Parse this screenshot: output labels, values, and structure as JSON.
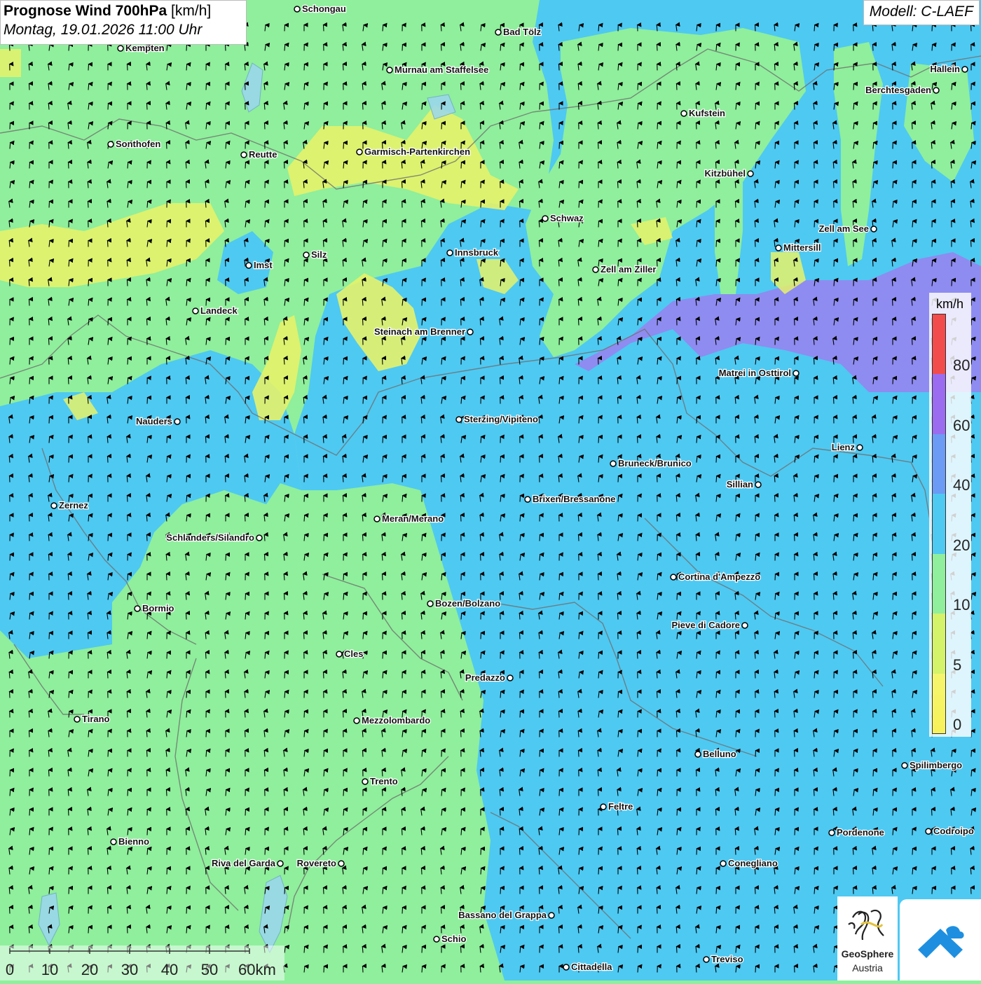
{
  "header": {
    "title_bold": "Prognose Wind 700hPa",
    "title_unit": "[km/h]",
    "date": "Montag, 19.01.2026 11:00 Uhr",
    "model": "Modell: C-LAEF"
  },
  "legend": {
    "unit": "km/h",
    "ticks": [
      "0",
      "5",
      "10",
      "20",
      "40",
      "60",
      "80"
    ],
    "colors": [
      "#f5f56e",
      "#d4f26a",
      "#8fef9c",
      "#4ec9f2",
      "#6b9bf5",
      "#9b6cf0",
      "#f24c4c"
    ]
  },
  "scale_bar": {
    "ticks": [
      "0",
      "10",
      "20",
      "30",
      "40",
      "50",
      "60km"
    ]
  },
  "logos": {
    "geosphere_line1": "GeoSphere",
    "geosphere_line2": "Austria"
  },
  "wind_field": {
    "dominant_direction": "north",
    "zones": [
      {
        "name": "west-green",
        "speed_class": "10-20"
      },
      {
        "name": "east-blue",
        "speed_class": "20-40"
      },
      {
        "name": "purple-band",
        "speed_class": "40-60"
      },
      {
        "name": "yellow-patches",
        "speed_class": "5-10"
      }
    ]
  },
  "cities": [
    {
      "name": "Schongau"
    },
    {
      "name": "Bad Tölz"
    },
    {
      "name": "Kempten"
    },
    {
      "name": "Murnau am Staffelsee"
    },
    {
      "name": "Hallein"
    },
    {
      "name": "Berchtesgaden"
    },
    {
      "name": "Kufstein"
    },
    {
      "name": "Sonthofen"
    },
    {
      "name": "Reutte"
    },
    {
      "name": "Garmisch-Partenkirchen"
    },
    {
      "name": "Kitzbühel"
    },
    {
      "name": "Schwaz"
    },
    {
      "name": "Zell am See"
    },
    {
      "name": "Silz"
    },
    {
      "name": "Innsbruck"
    },
    {
      "name": "Mittersill"
    },
    {
      "name": "Imst"
    },
    {
      "name": "Zell am Ziller"
    },
    {
      "name": "Landeck"
    },
    {
      "name": "Steinach am Brenner"
    },
    {
      "name": "Matrei in Osttirol"
    },
    {
      "name": "Nauders"
    },
    {
      "name": "Sterzing/Vipiteno"
    },
    {
      "name": "Lienz"
    },
    {
      "name": "Bruneck/Brunico"
    },
    {
      "name": "Sillian"
    },
    {
      "name": "Zernez"
    },
    {
      "name": "Brixen/Bressanone"
    },
    {
      "name": "Meran/Merano"
    },
    {
      "name": "Schlanders/Silandro"
    },
    {
      "name": "Cortina d'Ampezzo"
    },
    {
      "name": "Bozen/Bolzano"
    },
    {
      "name": "Bormio"
    },
    {
      "name": "Pieve di Cadore"
    },
    {
      "name": "Cles"
    },
    {
      "name": "Predazzo"
    },
    {
      "name": "Tirano"
    },
    {
      "name": "Mezzolombardo"
    },
    {
      "name": "Belluno"
    },
    {
      "name": "Spilimbergo"
    },
    {
      "name": "Trento"
    },
    {
      "name": "Feltre"
    },
    {
      "name": "Pordenone"
    },
    {
      "name": "Codroipo"
    },
    {
      "name": "Bienno"
    },
    {
      "name": "Riva del Garda"
    },
    {
      "name": "Rovereto"
    },
    {
      "name": "Conegliano"
    },
    {
      "name": "Bassano del Grappa"
    },
    {
      "name": "Schio"
    },
    {
      "name": "Treviso"
    },
    {
      "name": "Cittadella"
    }
  ]
}
